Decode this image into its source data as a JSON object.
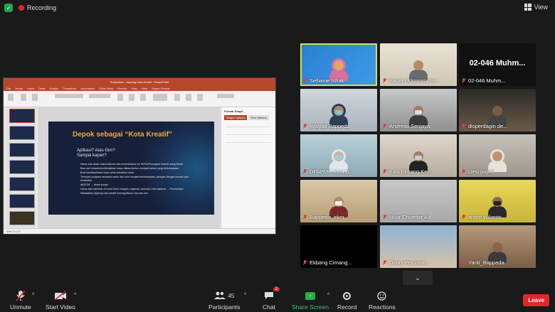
{
  "header": {
    "recording_label": "Recording",
    "view_label": "View"
  },
  "slide": {
    "title": "Depok sebagai “Kota Kreatif”",
    "q1": "Aplikasi? Atau Gim?",
    "q2": "Sampai kapan?",
    "bullets": [
      "Harus ada dasar hukum/aturan dan kebersihakan ke SKPD/Perangkat Daerah yang terkait",
      "Bisa dari infrastruktur/kebijakan kalau diatas bentuk menjadi sistem yang berkelanjutan",
      "Buat identitas/brand kota untuk subsektor ekraf",
      "Tentukan program bersama untuk dan buat menjadi berkelanjutan, jaringan dengan inovasi dan kreativitas",
      "ABGCM → harus punya",
      "Harus ada calendar of event lokal, wilayah, regional, nasional, internasional → Promosikan",
      "Manfaatkan jejaring kota kreatif sharing/diskusi dan lain-lain"
    ]
  },
  "ppt": {
    "window_title": "Presentasi - Jejaring Kota Kreatif - PowerPoint",
    "tabs": [
      "File",
      "Home",
      "Insert",
      "Draw",
      "Design",
      "Transitions",
      "Animations",
      "Slide Show",
      "Review",
      "View",
      "Help",
      "Shape Format"
    ],
    "panel_title": "Format Shape",
    "panel_tabs": [
      "Shape Options",
      "Text Options"
    ],
    "status": "Slide 3 of 13"
  },
  "participants": [
    {
      "name": "Sellianie Ishak",
      "speaker": true
    },
    {
      "name": "Bagian Ekonomi Se...",
      "speaker": false
    },
    {
      "name": "02-046  Muhm...",
      "speaker": false
    },
    {
      "name": "Widyati Bappeda",
      "speaker": false
    },
    {
      "name": "Andreas Senjaya",
      "speaker": false
    },
    {
      "name": "disperdagin de...",
      "speaker": false
    },
    {
      "name": "DPAPMK Kota D...",
      "speaker": false
    },
    {
      "name": "Kasi Ekbang Kec...",
      "speaker": false
    },
    {
      "name": "Desi pujiati",
      "speaker": false
    },
    {
      "name": "Bappeda_ekm",
      "speaker": false
    },
    {
      "name": "Noor Choedar Ali",
      "speaker": false
    },
    {
      "name": "anton yulianto",
      "speaker": false
    },
    {
      "name": "Ekbang Cimang...",
      "speaker": false
    },
    {
      "name": "Dinas Perumah...",
      "speaker": false
    },
    {
      "name": "Yanti_Bappeda",
      "speaker": false
    }
  ],
  "big_name": "02-046  Muhm...",
  "toolbar": {
    "unmute": "Unmute",
    "start_video": "Start Video",
    "participants": "Participants",
    "participants_count": "45",
    "chat": "Chat",
    "chat_badge": "2",
    "share_screen": "Share Screen",
    "record": "Record",
    "reactions": "Reactions",
    "leave": "Leave"
  }
}
